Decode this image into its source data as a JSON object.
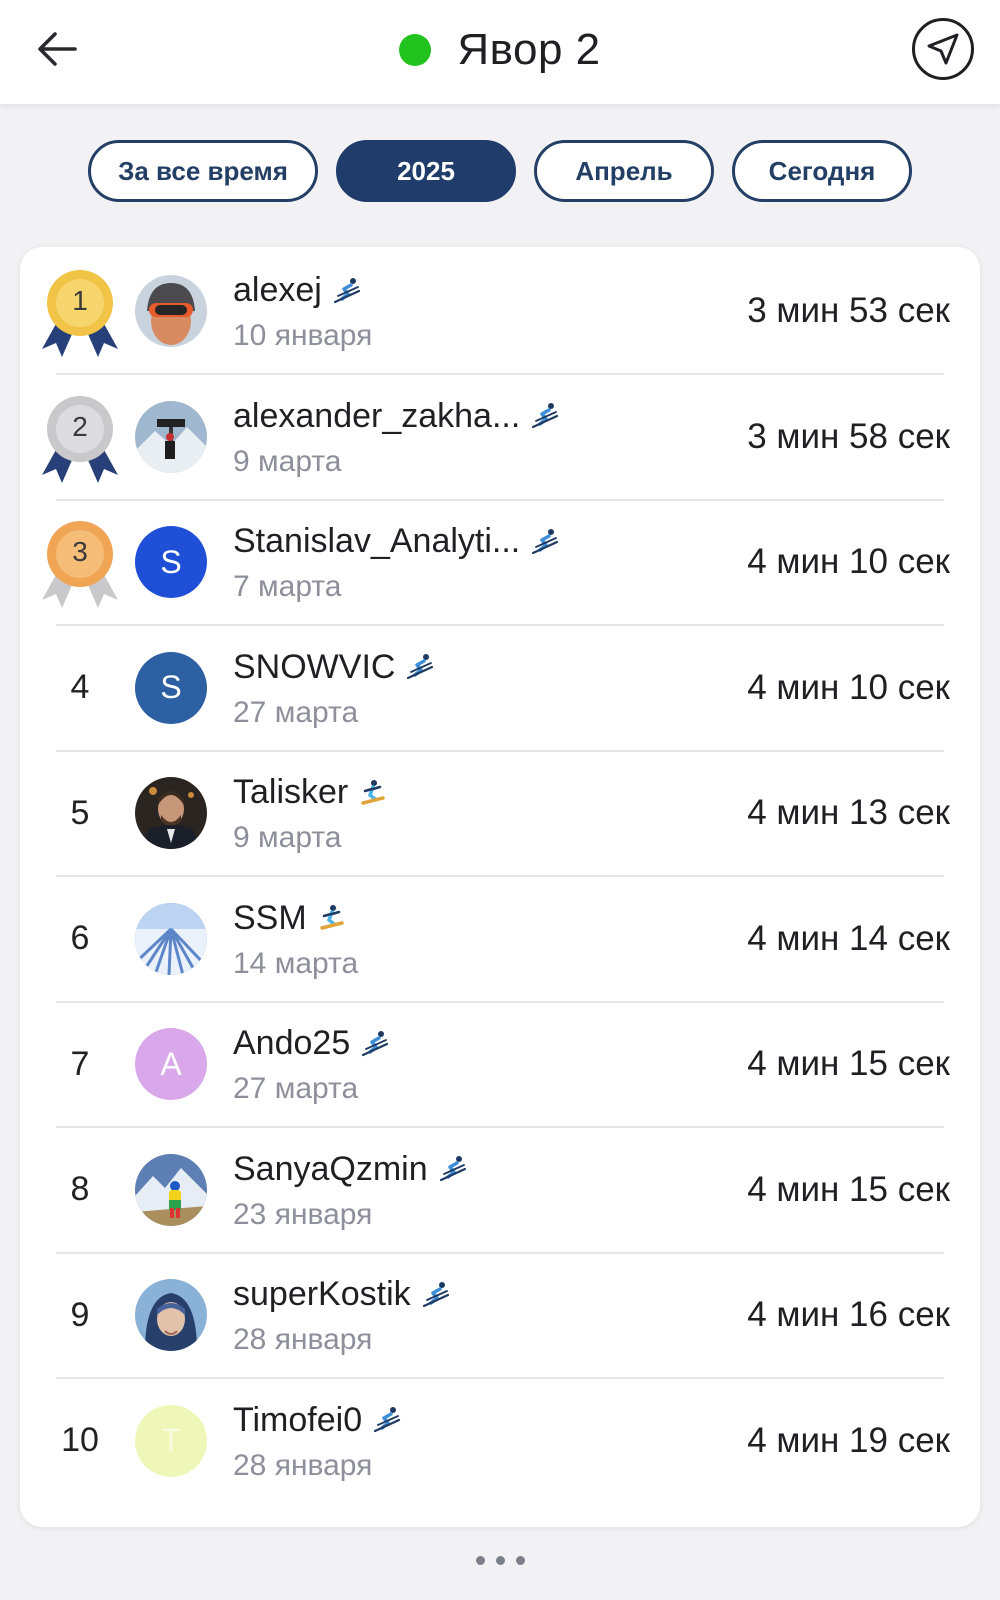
{
  "header": {
    "title": "Явор 2",
    "status_color": "#22c31f",
    "back_icon": "arrow-left-icon",
    "nav_icon": "navigation-arrow-icon"
  },
  "filters": [
    {
      "label": "За все время",
      "active": false
    },
    {
      "label": "2025",
      "active": true
    },
    {
      "label": "Апрель",
      "active": false
    },
    {
      "label": "Сегодня",
      "active": false
    }
  ],
  "leaderboard": [
    {
      "rank": "1",
      "medal": "gold",
      "name": "alexej",
      "sport": "skier-icon",
      "date": "10 января",
      "time": "3 мин 53 сек",
      "avatar": "photo"
    },
    {
      "rank": "2",
      "medal": "silver",
      "name": "alexander_zakha...",
      "sport": "skier-icon",
      "date": "9 марта",
      "time": "3 мин 58 сек",
      "avatar": "photo"
    },
    {
      "rank": "3",
      "medal": "bronze",
      "name": "Stanislav_Analyti...",
      "sport": "skier-icon",
      "date": "7 марта",
      "time": "4 мин 10 сек",
      "avatar": "S",
      "avatar_color": "#1f4fd6"
    },
    {
      "rank": "4",
      "medal": "",
      "name": "SNOWVIC",
      "sport": "skier-icon",
      "date": "27 марта",
      "time": "4 мин 10 сек",
      "avatar": "S",
      "avatar_color": "#2d5fa3"
    },
    {
      "rank": "5",
      "medal": "",
      "name": "Talisker",
      "sport": "snowboarder-icon",
      "date": "9 марта",
      "time": "4 мин 13 сек",
      "avatar": "photo"
    },
    {
      "rank": "6",
      "medal": "",
      "name": "SSM",
      "sport": "snowboarder-icon",
      "date": "14 марта",
      "time": "4 мин 14 сек",
      "avatar": "photo"
    },
    {
      "rank": "7",
      "medal": "",
      "name": "Ando25",
      "sport": "skier-icon",
      "date": "27 марта",
      "time": "4 мин 15 сек",
      "avatar": "A",
      "avatar_color": "#d9a8ea"
    },
    {
      "rank": "8",
      "medal": "",
      "name": "SanyaQzmin",
      "sport": "skier-icon",
      "date": "23 января",
      "time": "4 мин 15 сек",
      "avatar": "photo"
    },
    {
      "rank": "9",
      "medal": "",
      "name": "superKostik",
      "sport": "skier-icon",
      "date": "28 января",
      "time": "4 мин 16 сек",
      "avatar": "photo"
    },
    {
      "rank": "10",
      "medal": "",
      "name": "Timofei0",
      "sport": "skier-icon",
      "date": "28 января",
      "time": "4 мин 19 сек",
      "avatar": "T",
      "avatar_color": "#eef7b8"
    }
  ],
  "more_icon": "more-dots-icon"
}
